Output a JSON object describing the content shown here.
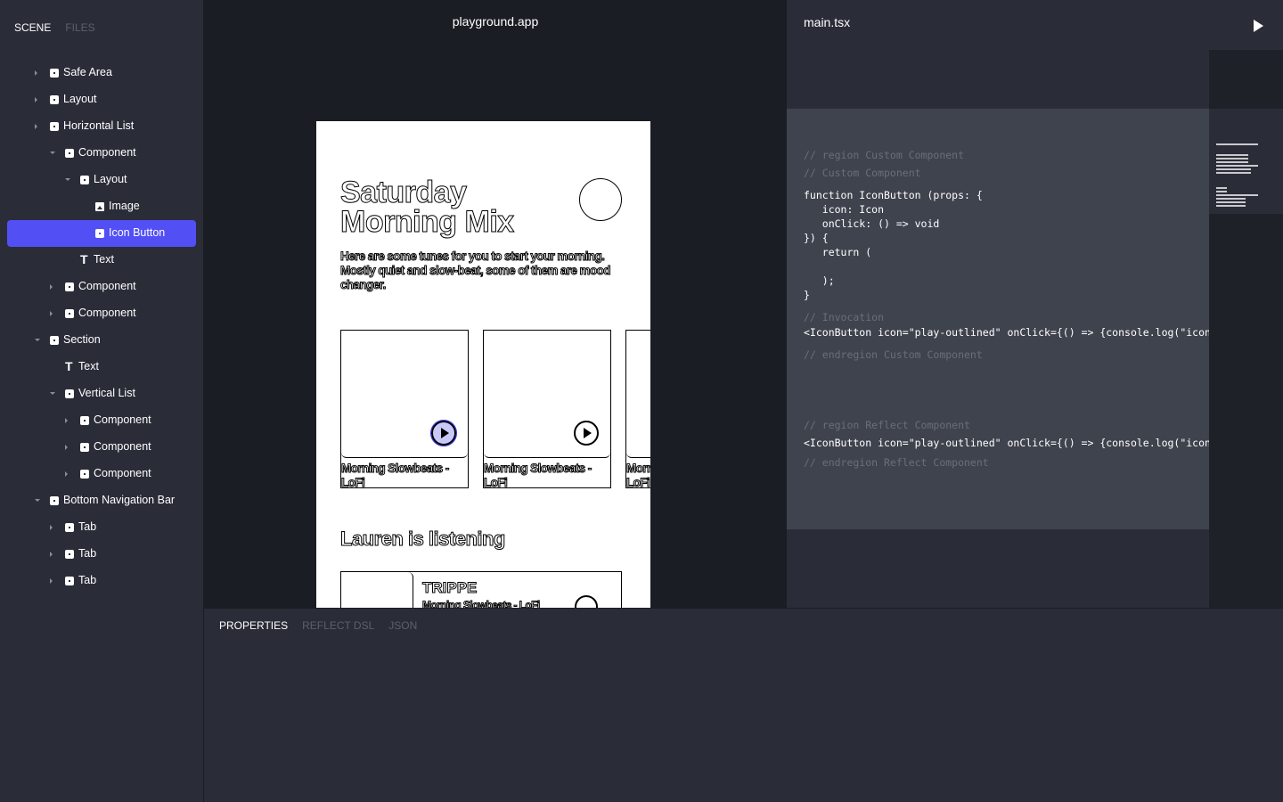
{
  "sidebar": {
    "tabs": [
      "SCENE",
      "FILES"
    ],
    "active_tab": 0,
    "tree": [
      {
        "label": "Safe Area",
        "level": 0,
        "icon": "component-icon",
        "state": "collapsed"
      },
      {
        "label": "Layout",
        "level": 0,
        "icon": "component-icon",
        "state": "collapsed"
      },
      {
        "label": "Horizontal List",
        "level": 0,
        "icon": "component-icon",
        "state": "collapsed"
      },
      {
        "label": "Component",
        "level": 1,
        "icon": "component-icon",
        "state": "expanded"
      },
      {
        "label": "Layout",
        "level": 2,
        "icon": "component-icon",
        "state": "expanded"
      },
      {
        "label": "Image",
        "level": 3,
        "icon": "image-icon",
        "state": "none"
      },
      {
        "label": "Icon Button",
        "level": 3,
        "icon": "component-icon",
        "state": "none",
        "selected": true
      },
      {
        "label": "Text",
        "level": 2,
        "icon": "text-icon",
        "state": "none"
      },
      {
        "label": "Component",
        "level": 1,
        "icon": "component-icon",
        "state": "collapsed"
      },
      {
        "label": "Component",
        "level": 1,
        "icon": "component-icon",
        "state": "collapsed"
      },
      {
        "label": "Section",
        "level": 0,
        "icon": "component-icon",
        "state": "expanded"
      },
      {
        "label": "Text",
        "level": 1,
        "icon": "text-icon",
        "state": "none"
      },
      {
        "label": "Vertical List",
        "level": 1,
        "icon": "component-icon",
        "state": "expanded"
      },
      {
        "label": "Component",
        "level": 2,
        "icon": "component-icon",
        "state": "collapsed"
      },
      {
        "label": "Component",
        "level": 2,
        "icon": "component-icon",
        "state": "collapsed"
      },
      {
        "label": "Component",
        "level": 2,
        "icon": "component-icon",
        "state": "collapsed"
      },
      {
        "label": "Bottom Navigation Bar",
        "level": 0,
        "icon": "component-icon",
        "state": "expanded"
      },
      {
        "label": "Tab",
        "level": 1,
        "icon": "component-icon",
        "state": "collapsed"
      },
      {
        "label": "Tab",
        "level": 1,
        "icon": "component-icon",
        "state": "collapsed"
      },
      {
        "label": "Tab",
        "level": 1,
        "icon": "component-icon",
        "state": "collapsed"
      }
    ]
  },
  "canvas": {
    "title": "playground.app",
    "phone": {
      "title_line1": "Saturday",
      "title_line2": "Morning Mix",
      "description": "Here are some tunes for you to start your morning. Mostly quiet and slow-beat, some of them are mood changer.",
      "cards": [
        "Morning Slowbeats - LoFi",
        "Morning Slowbeats - LoFi",
        "Morning Slowbeats - LoFi"
      ],
      "section_title": "Lauren is listening",
      "row": {
        "artist": "TRIPPE",
        "song": "Morning Slowbeats - LoFi"
      }
    }
  },
  "editor": {
    "file": "main.tsx",
    "lines": [
      {
        "text": "// region Custom Component",
        "comment": true
      },
      {
        "text": "// Custom Component",
        "comment": true
      },
      {
        "text": "function IconButton (props: {",
        "comment": false
      },
      {
        "text": "   icon: Icon",
        "comment": false
      },
      {
        "text": "   onClick: () => void",
        "comment": false
      },
      {
        "text": "}) {",
        "comment": false
      },
      {
        "text": "   return (",
        "comment": false
      },
      {
        "text": "   );",
        "comment": false
      },
      {
        "text": "}",
        "comment": false
      },
      {
        "text": "// Invocation",
        "comment": true
      },
      {
        "text": "<IconButton icon=\"play-outlined\" onClick={() => {console.log(\"icon button c",
        "comment": false
      },
      {
        "text": "// endregion Custom Component",
        "comment": true
      },
      {
        "text": "// region Reflect Component",
        "comment": true
      },
      {
        "text": "<IconButton icon=\"play-outlined\" onClick={() => {console.log(\"icon button c",
        "comment": false
      },
      {
        "text": "// endregion Reflect Component",
        "comment": true
      }
    ]
  },
  "bottom": {
    "tabs": [
      "PROPERTIES",
      "REFLECT DSL",
      "JSON"
    ],
    "active_tab": 0
  },
  "colors": {
    "accent": "#5250f5",
    "panel": "#2a2d38",
    "canvas": "#1b1d24",
    "region": "#3f434e"
  }
}
